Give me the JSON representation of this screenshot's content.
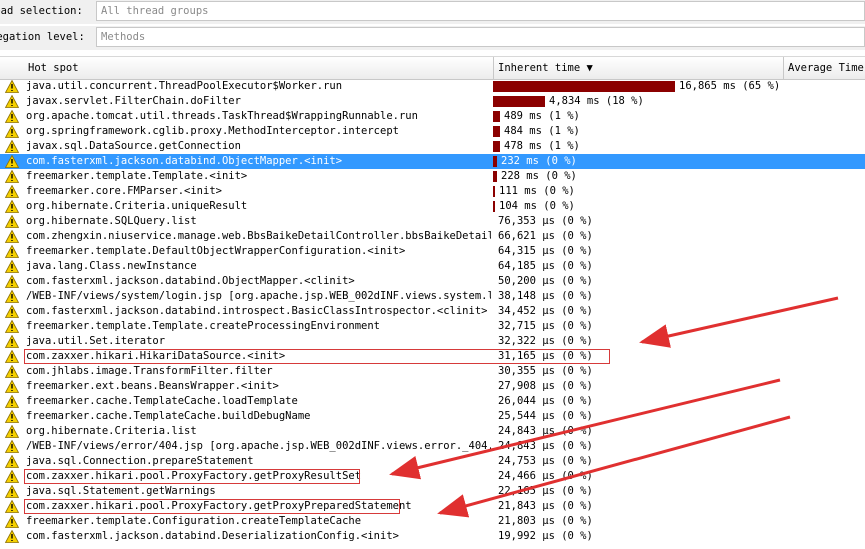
{
  "thread_selection": {
    "label": "read selection:",
    "value": "All thread groups"
  },
  "aggregation_level": {
    "label": "regation level:",
    "value": "Methods"
  },
  "columns": {
    "hot_spot": "Hot spot",
    "inherent_time": "Inherent time",
    "sort_arrow": "▼",
    "average_time": "Average Time"
  },
  "colors": {
    "bar": "#8b0000",
    "selected": "#3399ff",
    "warning": "#f5d000",
    "highlight": "#d63a3a"
  },
  "rows": [
    {
      "name": "java.util.concurrent.ThreadPoolExecutor$Worker.run",
      "time": "16,865 ms (65 %)",
      "pct": 65
    },
    {
      "name": "javax.servlet.FilterChain.doFilter",
      "time": "4,834 ms (18 %)",
      "pct": 18
    },
    {
      "name": "org.apache.tomcat.util.threads.TaskThread$WrappingRunnable.run",
      "time": "489 ms (1 %)",
      "pct": 1
    },
    {
      "name": "org.springframework.cglib.proxy.MethodInterceptor.intercept",
      "time": "484 ms (1 %)",
      "pct": 1
    },
    {
      "name": "javax.sql.DataSource.getConnection",
      "time": "478 ms (1 %)",
      "pct": 1
    },
    {
      "name": "com.fasterxml.jackson.databind.ObjectMapper.<init>",
      "time": "232 ms (0 %)",
      "pct": 0.5,
      "selected": true
    },
    {
      "name": "freemarker.template.Template.<init>",
      "time": "228 ms (0 %)",
      "pct": 0.5
    },
    {
      "name": "freemarker.core.FMParser.<init>",
      "time": "111 ms (0 %)",
      "pct": 0.25
    },
    {
      "name": "org.hibernate.Criteria.uniqueResult",
      "time": "104 ms (0 %)",
      "pct": 0.25
    },
    {
      "name": "org.hibernate.SQLQuery.list",
      "time": "76,353 µs (0 %)",
      "pct": 0
    },
    {
      "name": "com.zhengxin.niuservice.manage.web.BbsBaikeDetailController.bbsBaikeDetail...",
      "time": "66,621 µs (0 %)",
      "pct": 0
    },
    {
      "name": "freemarker.template.DefaultObjectWrapperConfiguration.<init>",
      "time": "64,315 µs (0 %)",
      "pct": 0
    },
    {
      "name": "java.lang.Class.newInstance",
      "time": "64,185 µs (0 %)",
      "pct": 0
    },
    {
      "name": "com.fasterxml.jackson.databind.ObjectMapper.<clinit>",
      "time": "50,200 µs (0 %)",
      "pct": 0
    },
    {
      "name": "/WEB-INF/views/system/login.jsp [org.apache.jsp.WEB_002dINF.views.system.l...",
      "time": "38,148 µs (0 %)",
      "pct": 0
    },
    {
      "name": "com.fasterxml.jackson.databind.introspect.BasicClassIntrospector.<clinit>",
      "time": "34,452 µs (0 %)",
      "pct": 0
    },
    {
      "name": "freemarker.template.Template.createProcessingEnvironment",
      "time": "32,715 µs (0 %)",
      "pct": 0
    },
    {
      "name": "java.util.Set.iterator",
      "time": "32,322 µs (0 %)",
      "pct": 0
    },
    {
      "name": "com.zaxxer.hikari.HikariDataSource.<init>",
      "time": "31,165 µs (0 %)",
      "pct": 0,
      "highlight": true
    },
    {
      "name": "com.jhlabs.image.TransformFilter.filter",
      "time": "30,355 µs (0 %)",
      "pct": 0
    },
    {
      "name": "freemarker.ext.beans.BeansWrapper.<init>",
      "time": "27,908 µs (0 %)",
      "pct": 0
    },
    {
      "name": "freemarker.cache.TemplateCache.loadTemplate",
      "time": "26,044 µs (0 %)",
      "pct": 0
    },
    {
      "name": "freemarker.cache.TemplateCache.buildDebugName",
      "time": "25,544 µs (0 %)",
      "pct": 0
    },
    {
      "name": "org.hibernate.Criteria.list",
      "time": "24,843 µs (0 %)",
      "pct": 0
    },
    {
      "name": "/WEB-INF/views/error/404.jsp [org.apache.jsp.WEB_002dINF.views.error._404...",
      "time": "24,843 µs (0 %)",
      "pct": 0
    },
    {
      "name": "java.sql.Connection.prepareStatement",
      "time": "24,753 µs (0 %)",
      "pct": 0
    },
    {
      "name": "com.zaxxer.hikari.pool.ProxyFactory.getProxyResultSet",
      "time": "24,466 µs (0 %)",
      "pct": 0,
      "highlight": true
    },
    {
      "name": "java.sql.Statement.getWarnings",
      "time": "22,165 µs (0 %)",
      "pct": 0
    },
    {
      "name": "com.zaxxer.hikari.pool.ProxyFactory.getProxyPreparedStatement",
      "time": "21,843 µs (0 %)",
      "pct": 0,
      "highlight": true
    },
    {
      "name": "freemarker.template.Configuration.createTemplateCache",
      "time": "21,803 µs (0 %)",
      "pct": 0
    },
    {
      "name": "com.fasterxml.jackson.databind.DeserializationConfig.<init>",
      "time": "19,992 µs (0 %)",
      "pct": 0
    }
  ]
}
